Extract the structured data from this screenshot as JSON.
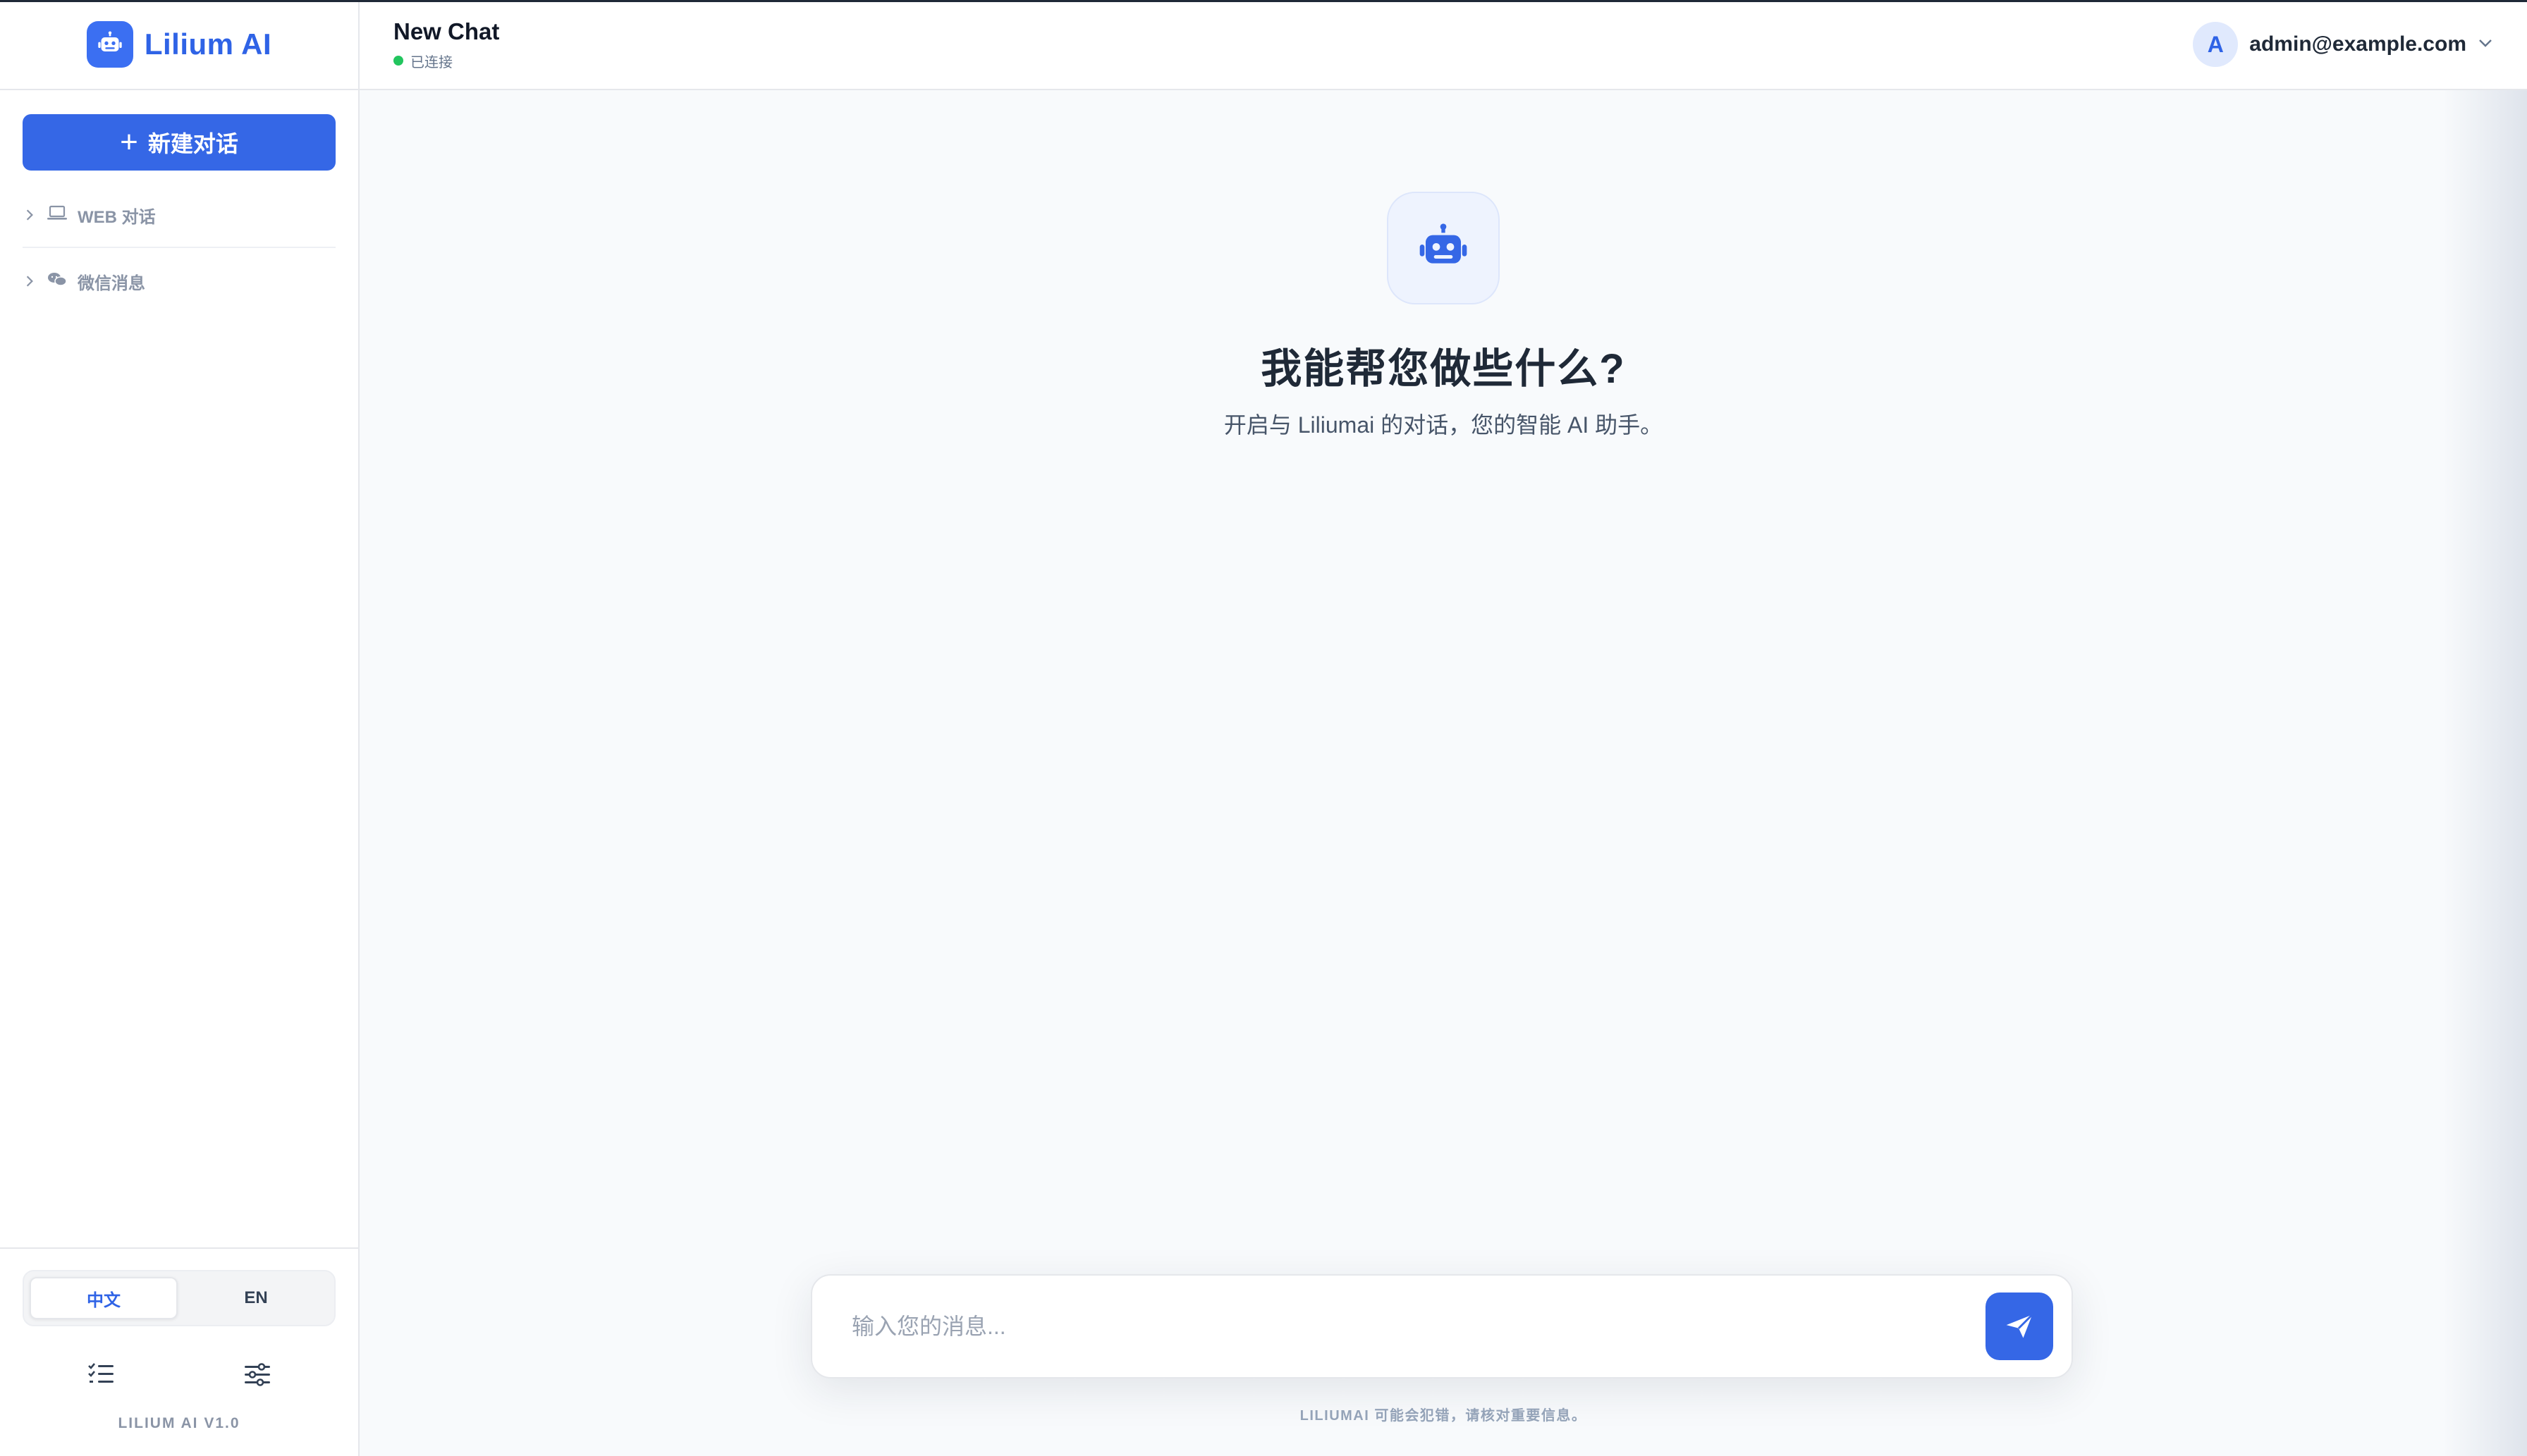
{
  "brand": {
    "name": "Lilium AI",
    "icon": "robot-icon",
    "accent": "#3567e6"
  },
  "sidebar": {
    "new_chat_label": "新建对话",
    "groups": [
      {
        "label": "WEB 对话",
        "icon": "laptop-icon"
      },
      {
        "label": "微信消息",
        "icon": "wechat-icon"
      }
    ],
    "language": {
      "options": [
        "中文",
        "EN"
      ],
      "selected": "中文"
    },
    "tools": [
      "task-list-icon",
      "sliders-icon"
    ],
    "version": "LILIUM AI V1.0"
  },
  "header": {
    "title": "New Chat",
    "status": "已连接",
    "status_color": "#22c55e",
    "user": {
      "avatar_letter": "A",
      "email": "admin@example.com"
    }
  },
  "welcome": {
    "title": "我能帮您做些什么?",
    "subtitle": "开启与 Liliumai 的对话，您的智能 AI 助手。"
  },
  "composer": {
    "placeholder": "输入您的消息...",
    "value": "",
    "disclaimer": "LILIUMAI 可能会犯错，请核对重要信息。"
  }
}
